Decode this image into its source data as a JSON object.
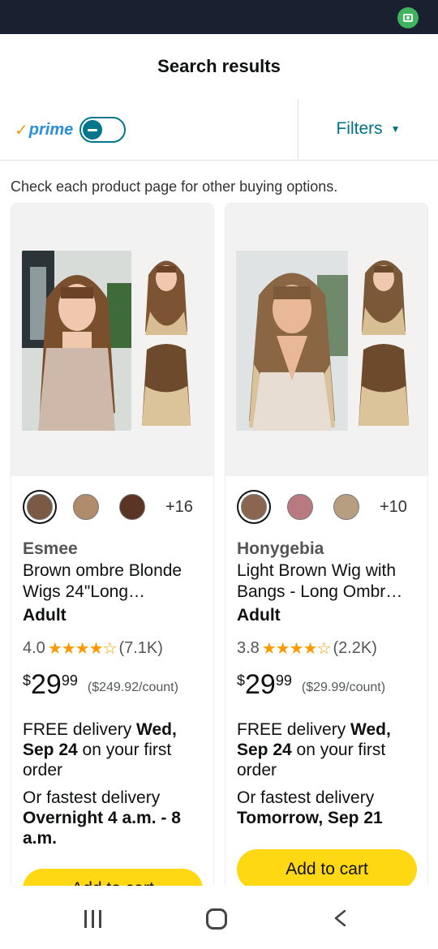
{
  "header": {
    "title": "Search results"
  },
  "filter_bar": {
    "prime_check": "✓",
    "prime_label": "prime",
    "filters_label": "Filters"
  },
  "notice": "Check each product page for other buying options.",
  "products": [
    {
      "brand": "Esmee",
      "title_line1": "Brown ombre Blonde",
      "title_line2": "Wigs 24\"Long…",
      "badge": "Adult",
      "rating": "4.0",
      "stars": "★★★★☆",
      "reviews": "(7.1K)",
      "price_currency": "$",
      "price_whole": "29",
      "price_fraction": "99",
      "unit_price": "($249.92/count)",
      "swatch_colors": [
        "#7a5a45",
        "#b08b6c",
        "#5a3424"
      ],
      "more_colors": "+16",
      "delivery_prefix": "FREE delivery ",
      "delivery_date": "Wed, Sep 24",
      "delivery_suffix": " on your first order",
      "fast_prefix": "Or fastest delivery ",
      "fast_date": "Overnight 4 a.m. - 8 a.m.",
      "cart_label": "Add to cart"
    },
    {
      "brand": "Honygebia",
      "title_line1": "Light Brown Wig with",
      "title_line2": "Bangs - Long Ombr…",
      "badge": "Adult",
      "rating": "3.8",
      "stars": "★★★★☆",
      "reviews": "(2.2K)",
      "price_currency": "$",
      "price_whole": "29",
      "price_fraction": "99",
      "unit_price": "($29.99/count)",
      "swatch_colors": [
        "#8a6650",
        "#b87a80",
        "#b89e80"
      ],
      "more_colors": "+10",
      "delivery_prefix": "FREE delivery ",
      "delivery_date": "Wed, Sep 24",
      "delivery_suffix": " on your first order",
      "fast_prefix": "Or fastest delivery ",
      "fast_date": "Tomorrow, Sep 21",
      "cart_label": "Add to cart"
    }
  ],
  "colors": {
    "accent": "#007185",
    "cart_button": "#ffd814",
    "star": "#ff9900",
    "status_bar": "#1b2030"
  }
}
